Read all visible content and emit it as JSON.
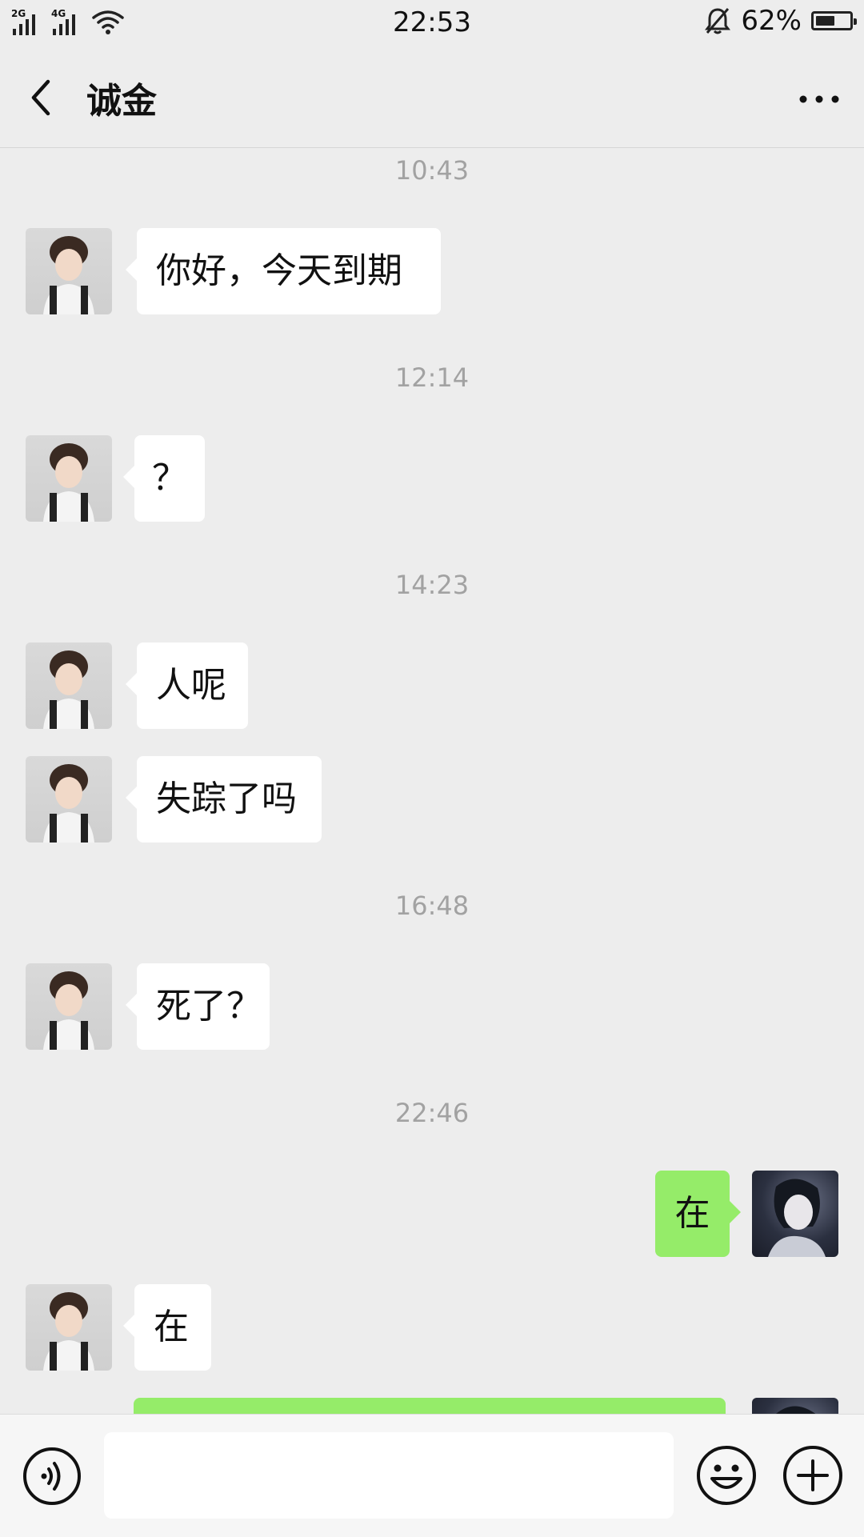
{
  "status_bar": {
    "signal1_label": "2G",
    "signal2_label": "4G",
    "time": "22:53",
    "battery_percent": "62%",
    "battery_level": 0.62
  },
  "header": {
    "title": "诚金"
  },
  "messages": [
    {
      "type": "time",
      "text": "10:43"
    },
    {
      "type": "in",
      "text": "你好，今天到期"
    },
    {
      "type": "time",
      "text": "12:14"
    },
    {
      "type": "in",
      "text": "？"
    },
    {
      "type": "time",
      "text": "14:23"
    },
    {
      "type": "in",
      "text": "人呢"
    },
    {
      "type": "in",
      "text": "失踪了吗"
    },
    {
      "type": "time",
      "text": "16:48"
    },
    {
      "type": "in",
      "text": "死了？"
    },
    {
      "type": "time",
      "text": "22:46"
    },
    {
      "type": "out",
      "text": "在"
    },
    {
      "type": "in",
      "text": "在"
    },
    {
      "type": "out",
      "text": ""
    }
  ],
  "input": {
    "value": "",
    "placeholder": ""
  },
  "icons": {
    "back": "chevron-left-icon",
    "more": "more-dots-icon",
    "voice": "voice-icon",
    "emoji": "emoji-icon",
    "plus": "plus-icon"
  },
  "colors": {
    "background": "#ededed",
    "outgoing_bubble": "#95ec69",
    "incoming_bubble": "#ffffff",
    "timestamp": "#a2a2a2"
  }
}
